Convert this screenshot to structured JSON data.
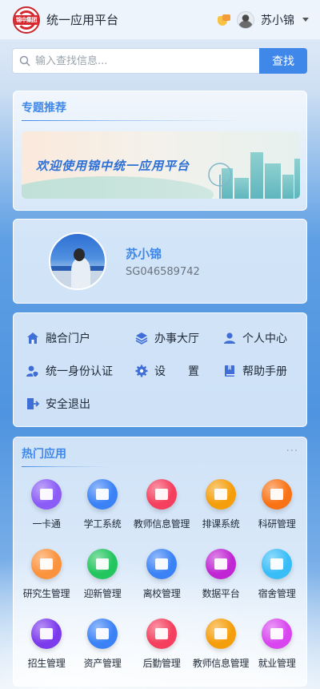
{
  "header": {
    "logo_text": "锦中集团",
    "title": "统一应用平台",
    "user_name": "苏小锦"
  },
  "search": {
    "placeholder": "输入查找信息...",
    "button_label": "查找"
  },
  "featured": {
    "title": "专题推荐",
    "banner_text": "欢迎使用锦中统一应用平台"
  },
  "profile": {
    "name": "苏小锦",
    "id": "SG046589742"
  },
  "quick_menu": [
    {
      "label": "融合门户",
      "icon": "home-icon"
    },
    {
      "label": "办事大厅",
      "icon": "layers-icon"
    },
    {
      "label": "个人中心",
      "icon": "user-icon"
    },
    {
      "label": "统一身份认证",
      "icon": "user-shield-icon"
    },
    {
      "label": "设　　置",
      "icon": "gear-icon"
    },
    {
      "label": "帮助手册",
      "icon": "book-icon"
    },
    {
      "label": "安全退出",
      "icon": "logout-icon"
    }
  ],
  "hot_apps": {
    "title": "热门应用",
    "more": "···",
    "items": [
      {
        "label": "一卡通",
        "icon": "card-icon",
        "color": "#8b5cf6"
      },
      {
        "label": "学工系统",
        "icon": "search-doc-icon",
        "color": "#3b82f6"
      },
      {
        "label": "教师信息管理",
        "icon": "clipboard-icon",
        "color": "#f43f5e"
      },
      {
        "label": "排课系统",
        "icon": "calendar-icon",
        "color": "#f59e0b"
      },
      {
        "label": "科研管理",
        "icon": "presentation-icon",
        "color": "#f97316"
      },
      {
        "label": "研究生管理",
        "icon": "graduation-cap-icon",
        "color": "#fb923c"
      },
      {
        "label": "迎新管理",
        "icon": "users-icon",
        "color": "#22c55e"
      },
      {
        "label": "离校管理",
        "icon": "bank-icon",
        "color": "#3b82f6"
      },
      {
        "label": "数据平台",
        "icon": "pie-chart-icon",
        "color": "#c026d3"
      },
      {
        "label": "宿舍管理",
        "icon": "building-icon",
        "color": "#38bdf8"
      },
      {
        "label": "招生管理",
        "icon": "contact-book-icon",
        "color": "#7c3aed"
      },
      {
        "label": "资产管理",
        "icon": "yen-box-icon",
        "color": "#3b82f6"
      },
      {
        "label": "后勤管理",
        "icon": "heart-hand-icon",
        "color": "#f43f5e"
      },
      {
        "label": "教师信息管理",
        "icon": "teacher-icon",
        "color": "#f59e0b"
      },
      {
        "label": "就业管理",
        "icon": "briefcase-icon",
        "color": "#d946ef"
      }
    ]
  }
}
